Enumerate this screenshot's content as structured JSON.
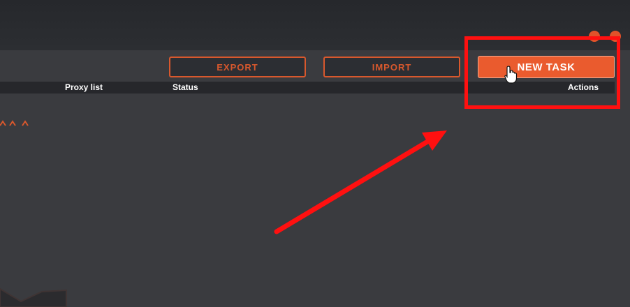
{
  "toolbar": {
    "export_label": "EXPORT",
    "import_label": "IMPORT",
    "new_task_label": "NEW TASK"
  },
  "table": {
    "columns": [
      "Proxy list",
      "Status",
      "Actions"
    ]
  },
  "colors": {
    "accent": "#ea5b2e",
    "background": "#3a3b3f",
    "header": "#26272b",
    "annotation": "#ff1010"
  },
  "icons": {
    "cursor": "hand-pointer-icon",
    "minimize": "minimize-icon",
    "close": "close-icon"
  }
}
